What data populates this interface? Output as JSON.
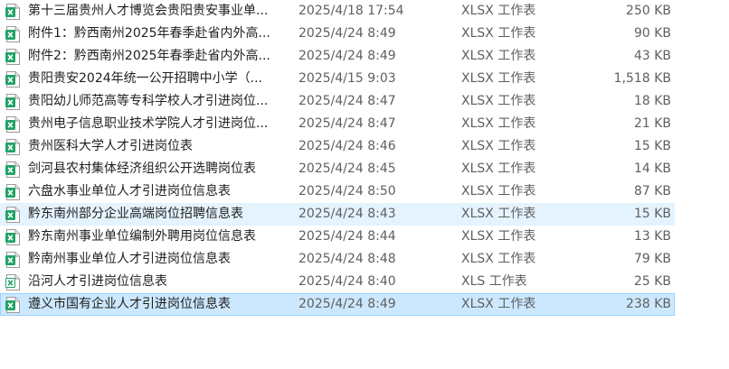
{
  "colors": {
    "xlsx_icon": "#21a366",
    "xls_icon": "#ffffff",
    "selected_bg": "#cce8ff",
    "hover_bg": "#e5f3ff"
  },
  "files": [
    {
      "name": "第十三届贵州人才博览会贵阳贵安事业单...",
      "modified": "2025/4/18 17:54",
      "type": "XLSX 工作表",
      "size": "250 KB",
      "icon": "xlsx-file-icon",
      "state": ""
    },
    {
      "name": "附件1：黔西南州2025年春季赴省内外高...",
      "modified": "2025/4/24 8:49",
      "type": "XLSX 工作表",
      "size": "90 KB",
      "icon": "xlsx-file-icon",
      "state": ""
    },
    {
      "name": "附件2：黔西南州2025年春季赴省内外高...",
      "modified": "2025/4/24 8:49",
      "type": "XLSX 工作表",
      "size": "43 KB",
      "icon": "xlsx-file-icon",
      "state": ""
    },
    {
      "name": "贵阳贵安2024年统一公开招聘中小学（...",
      "modified": "2025/4/15 9:03",
      "type": "XLSX 工作表",
      "size": "1,518 KB",
      "icon": "xlsx-file-icon",
      "state": ""
    },
    {
      "name": "贵阳幼儿师范高等专科学校人才引进岗位...",
      "modified": "2025/4/24 8:47",
      "type": "XLSX 工作表",
      "size": "18 KB",
      "icon": "xlsx-file-icon",
      "state": ""
    },
    {
      "name": "贵州电子信息职业技术学院人才引进岗位...",
      "modified": "2025/4/24 8:47",
      "type": "XLSX 工作表",
      "size": "21 KB",
      "icon": "xlsx-file-icon",
      "state": ""
    },
    {
      "name": "贵州医科大学人才引进岗位表",
      "modified": "2025/4/24 8:46",
      "type": "XLSX 工作表",
      "size": "15 KB",
      "icon": "xlsx-file-icon",
      "state": ""
    },
    {
      "name": "剑河县农村集体经济组织公开选聘岗位表",
      "modified": "2025/4/24 8:45",
      "type": "XLSX 工作表",
      "size": "14 KB",
      "icon": "xlsx-file-icon",
      "state": ""
    },
    {
      "name": "六盘水事业单位人才引进岗位信息表",
      "modified": "2025/4/24 8:50",
      "type": "XLSX 工作表",
      "size": "87 KB",
      "icon": "xlsx-file-icon",
      "state": ""
    },
    {
      "name": "黔东南州部分企业高端岗位招聘信息表",
      "modified": "2025/4/24 8:43",
      "type": "XLSX 工作表",
      "size": "15 KB",
      "icon": "xlsx-file-icon",
      "state": "hover"
    },
    {
      "name": "黔东南州事业单位编制外聘用岗位信息表",
      "modified": "2025/4/24 8:44",
      "type": "XLSX 工作表",
      "size": "13 KB",
      "icon": "xlsx-file-icon",
      "state": ""
    },
    {
      "name": "黔南州事业单位人才引进岗位信息表",
      "modified": "2025/4/24 8:48",
      "type": "XLSX 工作表",
      "size": "79 KB",
      "icon": "xlsx-file-icon",
      "state": ""
    },
    {
      "name": "沿河人才引进岗位信息表",
      "modified": "2025/4/24 8:40",
      "type": "XLS 工作表",
      "size": "25 KB",
      "icon": "xls-file-icon",
      "state": ""
    },
    {
      "name": "遵义市国有企业人才引进岗位信息表",
      "modified": "2025/4/24 8:49",
      "type": "XLSX 工作表",
      "size": "238 KB",
      "icon": "xlsx-file-icon",
      "state": "selected"
    }
  ]
}
